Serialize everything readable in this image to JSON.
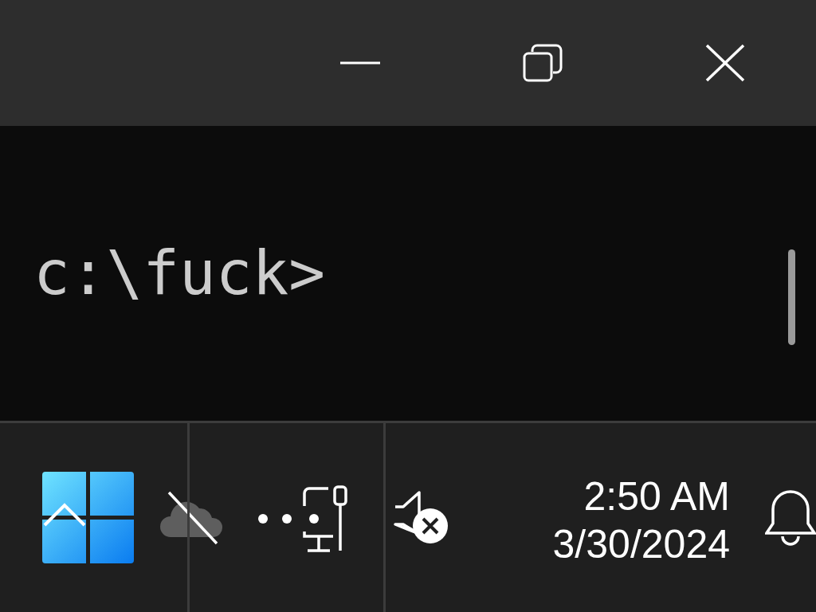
{
  "terminal": {
    "prompt": "c:\\fuck>"
  },
  "taskbar": {
    "time": "2:50 AM",
    "date": "3/30/2024"
  }
}
